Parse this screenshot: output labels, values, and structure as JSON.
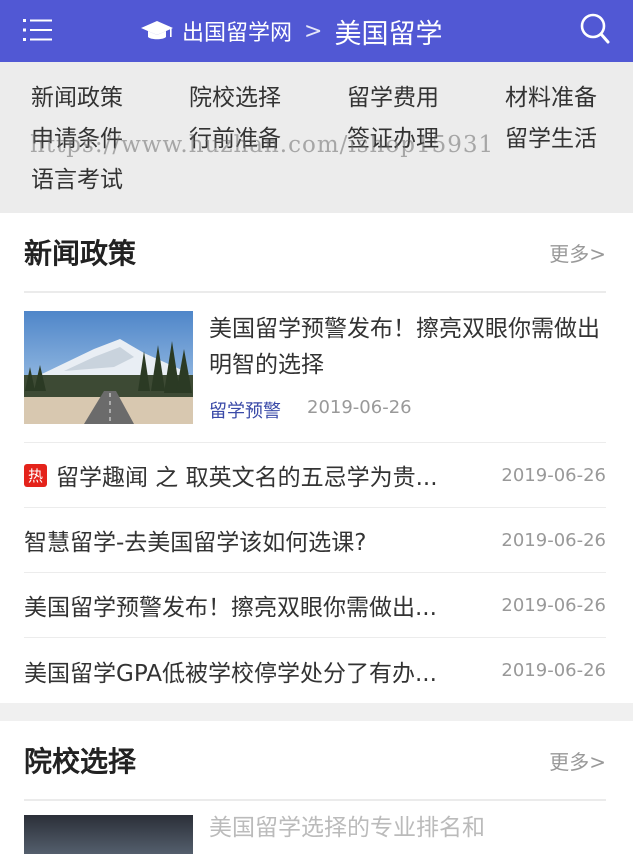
{
  "header": {
    "menu_icon": "menu-icon",
    "cap_icon": "graduation-cap-icon",
    "site_name": "出国留学网",
    "separator": ">",
    "current": "美国留学",
    "search_icon": "search-icon",
    "bg_color": "#5158d4"
  },
  "subnav": {
    "items": [
      "新闻政策",
      "院校选择",
      "留学费用",
      "材料准备",
      "申请条件",
      "行前准备",
      "签证办理",
      "留学生活",
      "语言考试"
    ],
    "watermark": "https://www.huzhan.com/ishop15931"
  },
  "news": {
    "title": "新闻政策",
    "more": "更多>",
    "feature": {
      "title": "美国留学预警发布！擦亮双眼你需做出明智的选择",
      "tag": "留学预警",
      "date": "2019-06-26"
    },
    "items": [
      {
        "hot": "热",
        "title": "留学趣闻 之 取英文名的五忌学为贵...",
        "date": "2019-06-26"
      },
      {
        "hot": "",
        "title": "智慧留学-去美国留学该如何选课?",
        "date": "2019-06-26"
      },
      {
        "hot": "",
        "title": "美国留学预警发布！擦亮双眼你需做出...",
        "date": "2019-06-26"
      },
      {
        "hot": "",
        "title": "美国留学GPA低被学校停学处分了有办...",
        "date": "2019-06-26"
      }
    ]
  },
  "schools": {
    "title": "院校选择",
    "more": "更多>",
    "peek_text": "美国留学选择的专业排名和"
  }
}
